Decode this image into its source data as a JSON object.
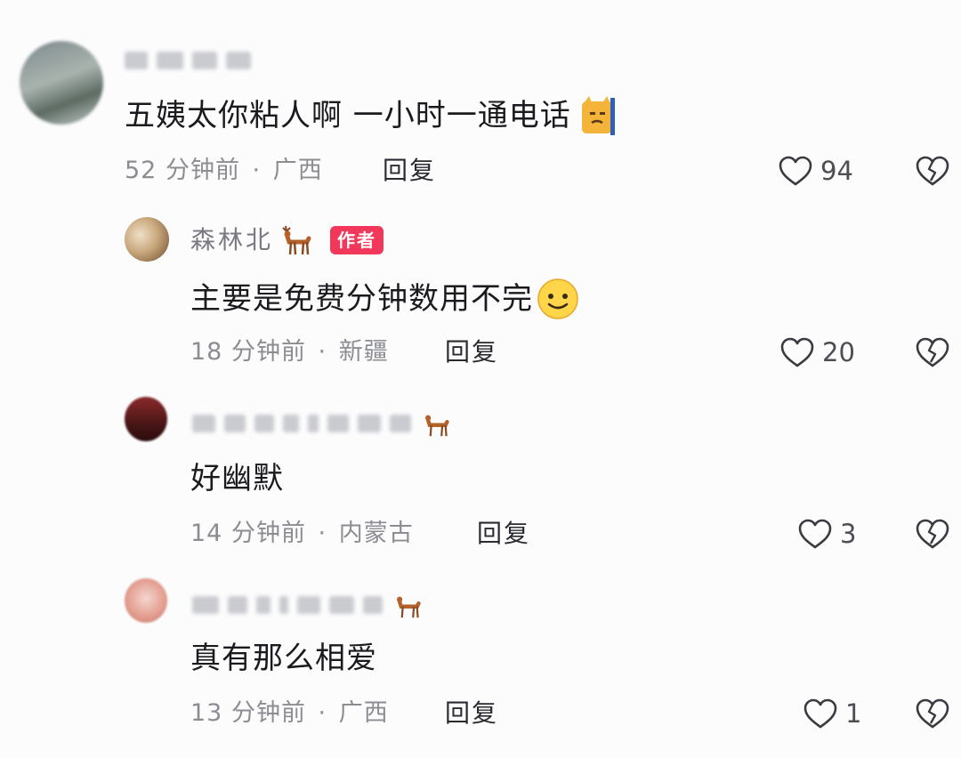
{
  "comments": [
    {
      "text": "五姨太你粘人啊 一小时一通电话",
      "time": "52 分钟前",
      "location": "广西",
      "reply_label": "回复",
      "likes": "94",
      "emoji": "cat-face-icon"
    },
    {
      "username": "森林北",
      "badge": "作者",
      "text": "主要是免费分钟数用不完",
      "time": "18 分钟前",
      "location": "新疆",
      "reply_label": "回复",
      "likes": "20",
      "emoji": "smile-face-icon"
    },
    {
      "text": "好幽默",
      "time": "14 分钟前",
      "location": "内蒙古",
      "reply_label": "回复",
      "likes": "3"
    },
    {
      "text": "真有那么相爱",
      "time": "13 分钟前",
      "location": "广西",
      "reply_label": "回复",
      "likes": "1"
    }
  ],
  "separator": "·",
  "colors": {
    "background": "#fcfcfd",
    "text": "#1b1b1f",
    "meta": "#8c8d93",
    "author_badge": "#f2385a"
  }
}
